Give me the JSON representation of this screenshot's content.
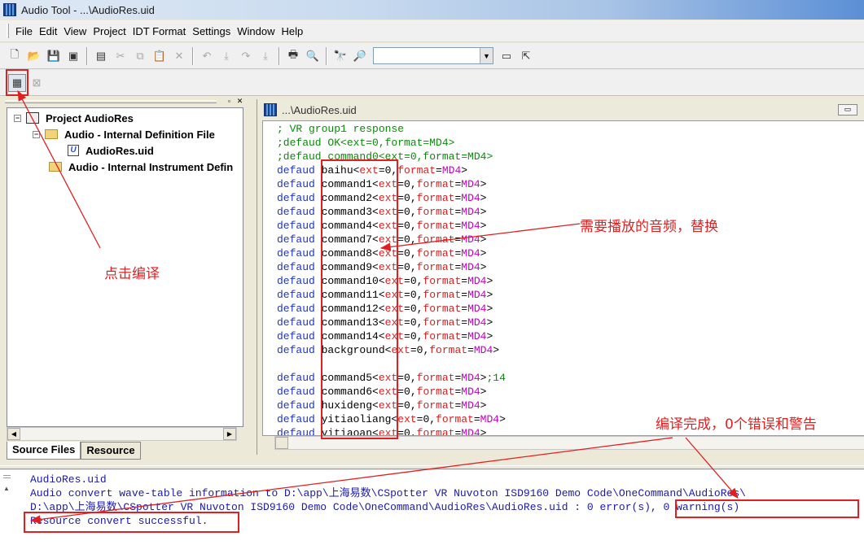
{
  "window": {
    "title": "Audio Tool - ...\\AudioRes.uid"
  },
  "menu": [
    "File",
    "Edit",
    "View",
    "Project",
    "IDT Format",
    "Settings",
    "Window",
    "Help"
  ],
  "toolbar": {
    "combo_value": ""
  },
  "project_tree": {
    "root": "Project AudioRes",
    "items": [
      {
        "label": "Audio - Internal Definition File"
      },
      {
        "label": "AudioRes.uid"
      },
      {
        "label": "Audio - Internal Instrument Defin"
      }
    ]
  },
  "tabs": {
    "source_files": "Source Files",
    "resource": "Resource"
  },
  "editor": {
    "title": "...\\AudioRes.uid",
    "comment_lines": [
      "; VR group1 response",
      ";defaud OK<ext=0,format=MD4>",
      ";defaud command0<ext=0,format=MD4>"
    ],
    "keyword": "defaud",
    "attr_ext": "ext",
    "attr_format": "format",
    "value_md4": "MD4",
    "entries_group1": [
      "baihu",
      "command1",
      "command2",
      "command3",
      "command4",
      "command7",
      "command8",
      "command9",
      "command10",
      "command11",
      "command12",
      "command13",
      "command14",
      "background"
    ],
    "entries_group2": [
      "command5",
      "command6",
      "huxideng",
      "yitiaoliang",
      "yitiaoan"
    ],
    "command5_comment": ";14"
  },
  "output": {
    "lines": [
      "AudioRes.uid",
      "Audio convert wave-table information to D:\\app\\上海易数\\CSpotter VR Nuvoton ISD9160 Demo Code\\OneCommand\\AudioRes\\",
      "D:\\app\\上海易数\\CSpotter VR Nuvoton ISD9160 Demo Code\\OneCommand\\AudioRes\\AudioRes.uid : 0 error(s), 0 warning(s)",
      "Resource convert successful."
    ]
  },
  "annotations": {
    "compile": "点击编译",
    "replace_audio": "需要播放的音频，替换",
    "compile_done": "编译完成，0个错误和警告"
  },
  "colors": {
    "annotation": "#e02020",
    "keyword": "#1c34c8",
    "comment": "#0a8a0a",
    "attr": "#d82020",
    "value": "#c000c0"
  }
}
